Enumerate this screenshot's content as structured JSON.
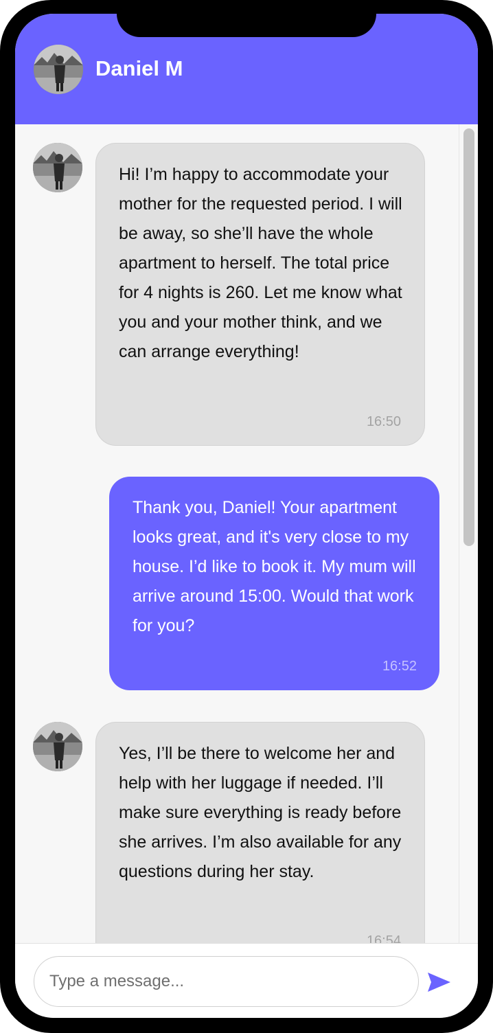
{
  "header": {
    "contact_name": "Daniel M",
    "avatar_icon": "person-photo-avatar"
  },
  "messages": [
    {
      "direction": "incoming",
      "text": "Hi! I’m happy to accommodate your mother for the requested period. I will be away, so she’ll have the whole apartment to herself. The total price for 4 nights is 260. Let me know what you and your mother think, and we can arrange everything!",
      "time": "16:50"
    },
    {
      "direction": "outgoing",
      "text": "Thank you, Daniel! Your apartment looks great, and it's very close to my house. I’d like to book it. My mum will arrive around 15:00. Would that work for you?",
      "time": "16:52"
    },
    {
      "direction": "incoming",
      "text": "Yes, I’ll be there to welcome her and help with her luggage if needed. I’ll make sure everything is ready before she arrives. I’m also available for any questions during her stay.",
      "time": "16:54"
    }
  ],
  "composer": {
    "placeholder": "Type a message...",
    "value": "",
    "send_icon": "send-arrow-icon"
  },
  "colors": {
    "accent": "#6a63ff",
    "incoming_bubble": "#e0e0e0",
    "background": "#f7f7f7"
  }
}
